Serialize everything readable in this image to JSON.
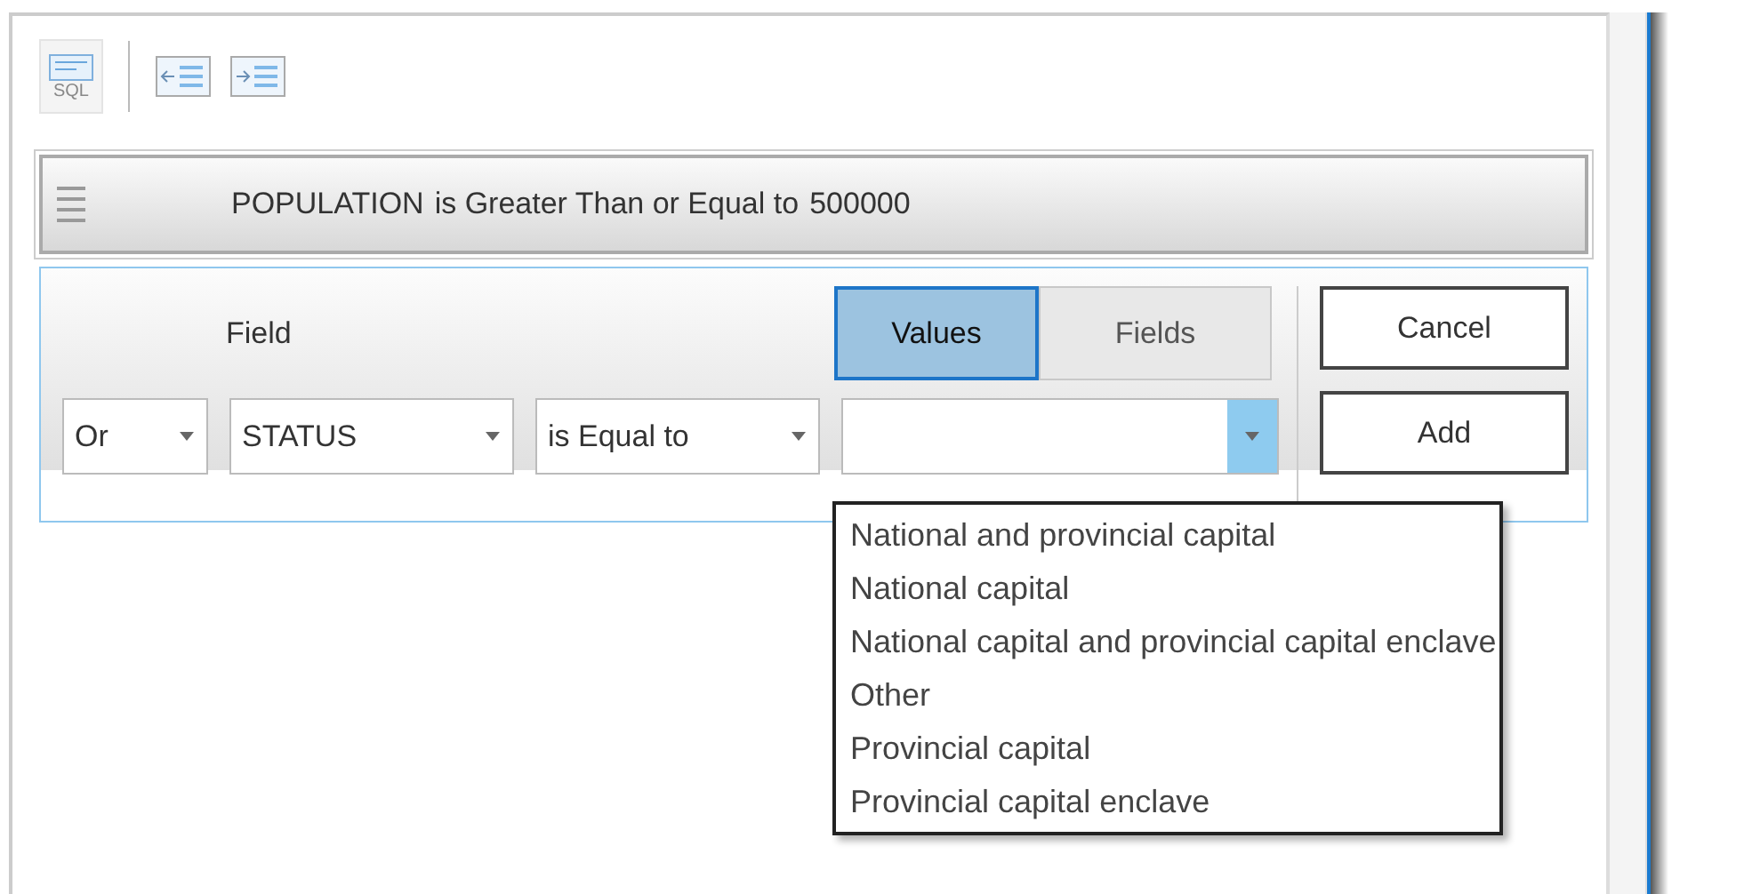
{
  "toolbar": {
    "sql_label": "SQL"
  },
  "clause": {
    "field": "POPULATION",
    "operator": "is Greater Than or Equal to",
    "value": "500000"
  },
  "editor": {
    "field_label": "Field",
    "source_tabs": [
      {
        "label": "Values",
        "selected": true
      },
      {
        "label": "Fields",
        "selected": false
      }
    ],
    "combos": [
      {
        "kind": "connector",
        "value": "Or"
      },
      {
        "kind": "field",
        "value": "STATUS"
      },
      {
        "kind": "operator",
        "value": "is Equal to"
      },
      {
        "kind": "value",
        "expanded": true
      }
    ],
    "buttons": [
      "Cancel",
      "Add"
    ],
    "options": [
      "National and provincial capital",
      "National capital",
      "National capital and provincial capital enclave",
      "Other",
      "Provincial capital",
      "Provincial capital enclave"
    ]
  }
}
